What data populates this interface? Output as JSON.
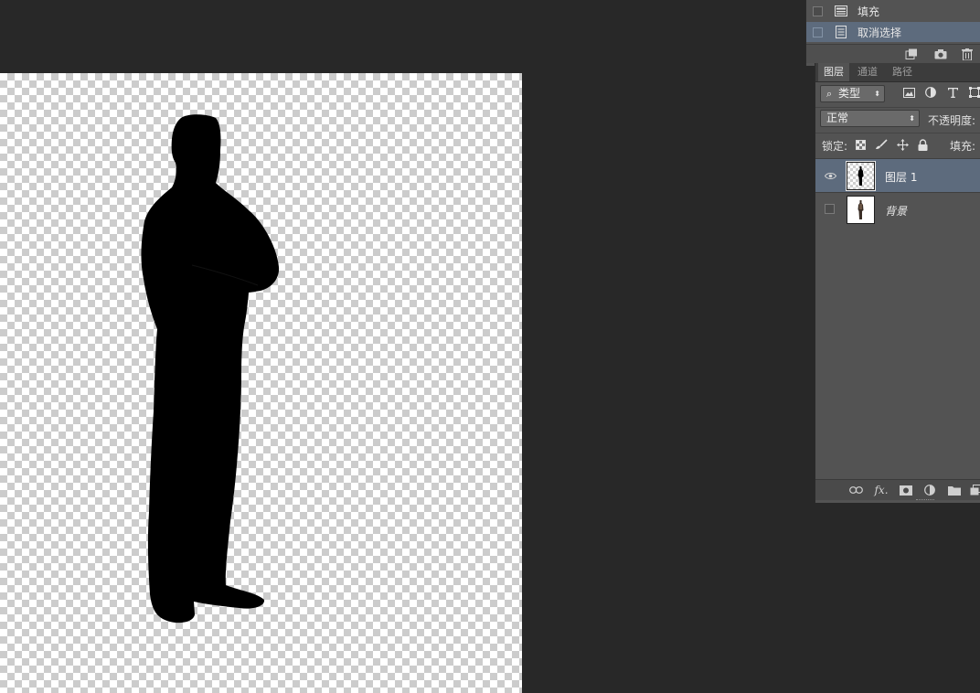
{
  "history": {
    "items": [
      {
        "label": "填充",
        "icon": "fill-icon",
        "selected": false
      },
      {
        "label": "取消选择",
        "icon": "deselect-icon",
        "selected": true
      }
    ],
    "footer_icons": [
      "new-document-from-state-icon",
      "camera-snapshot-icon",
      "trash-icon"
    ]
  },
  "layers_panel": {
    "tabs": [
      {
        "label": "图层",
        "active": true
      },
      {
        "label": "通道",
        "active": false
      },
      {
        "label": "路径",
        "active": false
      }
    ],
    "filter": {
      "search_glyph": "⌕",
      "kind_value": "类型",
      "icons": [
        "image-filter-icon",
        "adjustment-filter-icon",
        "type-filter-icon",
        "shape-filter-icon"
      ]
    },
    "blend_mode": "正常",
    "opacity_label": "不透明度:",
    "lock_label": "锁定:",
    "fill_label": "填充:",
    "lock_icons": [
      "lock-transparent-pixels-icon",
      "lock-image-pixels-icon",
      "lock-position-icon",
      "lock-all-icon"
    ],
    "layers": [
      {
        "name": "图层 1",
        "visible": true,
        "selected": true,
        "italic": false
      },
      {
        "name": "背景",
        "visible": false,
        "selected": false,
        "italic": true
      }
    ],
    "footer_icons": [
      "link-layers-icon",
      "fx-icon",
      "add-mask-icon",
      "new-adjustment-layer-icon",
      "new-group-icon",
      "new-layer-icon"
    ]
  },
  "colors": {
    "workspace": "#282828",
    "panel": "#535353",
    "selection": "#5d6b7d"
  }
}
